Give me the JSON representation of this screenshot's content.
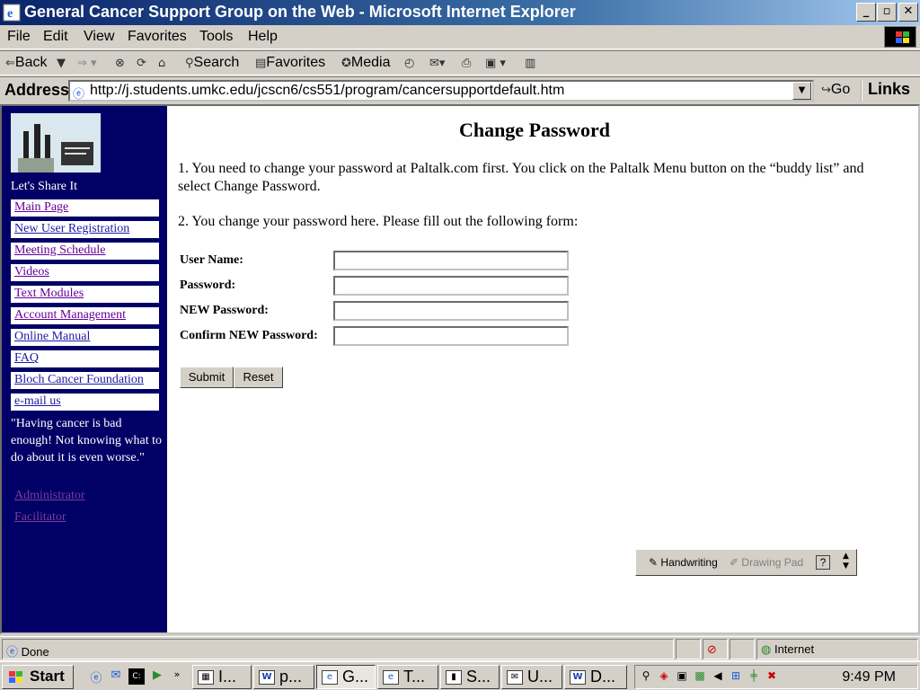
{
  "window": {
    "title": "General Cancer Support Group on the Web - Microsoft Internet Explorer",
    "minimize": "_",
    "maximize": "▫",
    "close": "✕"
  },
  "menu": [
    "File",
    "Edit",
    "View",
    "Favorites",
    "Tools",
    "Help"
  ],
  "toolbar": {
    "back": "Back",
    "search": "Search",
    "favorites": "Favorites",
    "media": "Media"
  },
  "address": {
    "label": "Address",
    "url": "http://j.students.umkc.edu/jcscn6/cs551/program/cancersupportdefault.htm",
    "go": "Go",
    "links": "Links"
  },
  "sidebar": {
    "tagline": "Let's Share It",
    "nav": [
      {
        "label": "Main Page",
        "visited": true
      },
      {
        "label": "New User Registration",
        "visited": false
      },
      {
        "label": "Meeting Schedule",
        "visited": true
      },
      {
        "label": "Videos",
        "visited": true
      },
      {
        "label": "Text Modules",
        "visited": true
      },
      {
        "label": "Account Management",
        "visited": true
      },
      {
        "label": "Online Manual",
        "visited": false
      },
      {
        "label": "FAQ",
        "visited": false
      },
      {
        "label": "Bloch Cancer Foundation",
        "visited": false
      },
      {
        "label": "e-mail us",
        "visited": false
      }
    ],
    "quote": "\"Having cancer is bad enough! Not knowing what to do about it is even worse.\"",
    "admin_links": [
      "Administrator",
      "Facilitator"
    ]
  },
  "main": {
    "title": "Change Password",
    "step1": "1. You need to change your password at Paltalk.com first.  You click on the Paltalk Menu button on the “buddy list” and select Change Password.",
    "step2": "2. You change your password here.  Please fill out the following form:",
    "form": {
      "fields": [
        {
          "label": "User Name:",
          "value": ""
        },
        {
          "label": "Password:",
          "value": ""
        },
        {
          "label": "NEW Password:",
          "value": ""
        },
        {
          "label": "Confirm NEW Password:",
          "value": ""
        }
      ],
      "submit": "Submit",
      "reset": "Reset"
    }
  },
  "handwriting": {
    "handwriting_label": "Handwriting",
    "drawing_pad_label": "Drawing Pad",
    "help": "?"
  },
  "status": {
    "text": "Done",
    "zone": "Internet"
  },
  "taskbar": {
    "start": "Start",
    "tasks": [
      {
        "label": "I...",
        "icon": "paint-icon"
      },
      {
        "label": "p...",
        "icon": "word-icon"
      },
      {
        "label": "G...",
        "icon": "ie-icon",
        "active": true
      },
      {
        "label": "T...",
        "icon": "ie-icon"
      },
      {
        "label": "S...",
        "icon": "app-icon"
      },
      {
        "label": "U...",
        "icon": "mail-icon"
      },
      {
        "label": "D...",
        "icon": "word-icon"
      }
    ],
    "clock": "9:49 PM"
  },
  "colors": {
    "sidebar_bg": "#000066",
    "link": "#1a1aa6",
    "visited_link": "#660099",
    "titlebar": "#0a246a"
  }
}
